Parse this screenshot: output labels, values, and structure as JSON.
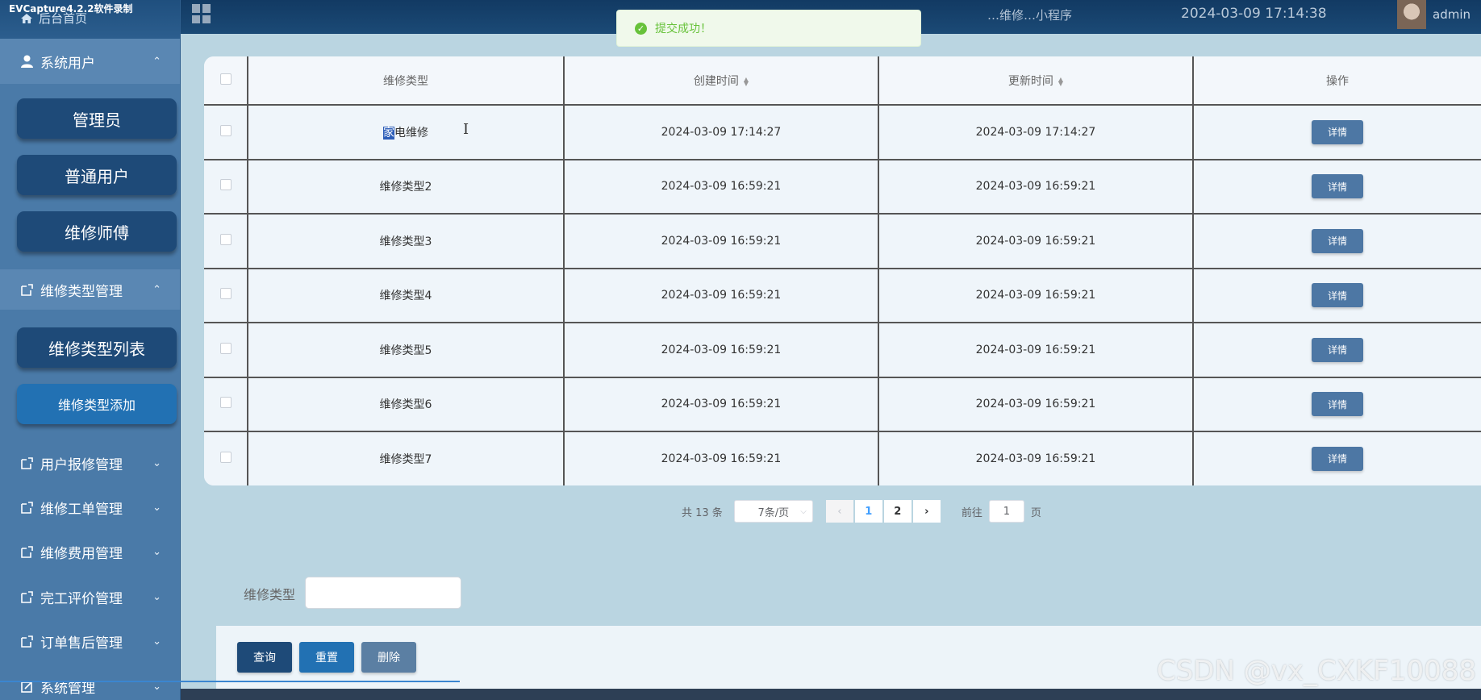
{
  "recorder_watermark": "EVCapture4.2.2软件录制",
  "sidebar": {
    "home_label": "后台首页",
    "groups": [
      {
        "label": "系统用户",
        "arrow": "⌃"
      },
      {
        "label": "维修类型管理",
        "arrow": "⌃"
      },
      {
        "label": "用户报修管理",
        "arrow": "⌄"
      },
      {
        "label": "维修工单管理",
        "arrow": "⌄"
      },
      {
        "label": "维修费用管理",
        "arrow": "⌄"
      },
      {
        "label": "完工评价管理",
        "arrow": "⌄"
      },
      {
        "label": "订单售后管理",
        "arrow": "⌄"
      },
      {
        "label": "系统管理",
        "arrow": "⌄"
      }
    ],
    "user_items": [
      "管理员",
      "普通用户",
      "维修师傅"
    ],
    "type_items": [
      "维修类型列表",
      "维修类型添加"
    ]
  },
  "header": {
    "title": "…维修…小程序",
    "datetime": "2024-03-09 17:14:38",
    "username": "admin"
  },
  "toast": {
    "message": "提交成功！"
  },
  "table": {
    "columns": [
      "维修类型",
      "创建时间",
      "更新时间",
      "操作"
    ],
    "rows": [
      {
        "type_first": "家",
        "type_rest": "电维修",
        "created": "2024-03-09 17:14:27",
        "updated": "2024-03-09 17:14:27"
      },
      {
        "type_first": "",
        "type_rest": "维修类型2",
        "created": "2024-03-09 16:59:21",
        "updated": "2024-03-09 16:59:21"
      },
      {
        "type_first": "",
        "type_rest": "维修类型3",
        "created": "2024-03-09 16:59:21",
        "updated": "2024-03-09 16:59:21"
      },
      {
        "type_first": "",
        "type_rest": "维修类型4",
        "created": "2024-03-09 16:59:21",
        "updated": "2024-03-09 16:59:21"
      },
      {
        "type_first": "",
        "type_rest": "维修类型5",
        "created": "2024-03-09 16:59:21",
        "updated": "2024-03-09 16:59:21"
      },
      {
        "type_first": "",
        "type_rest": "维修类型6",
        "created": "2024-03-09 16:59:21",
        "updated": "2024-03-09 16:59:21"
      },
      {
        "type_first": "",
        "type_rest": "维修类型7",
        "created": "2024-03-09 16:59:21",
        "updated": "2024-03-09 16:59:21"
      }
    ],
    "detail_label": "详情"
  },
  "pagination": {
    "total_text": "共 13 条",
    "page_size": "7条/页",
    "prev": "‹",
    "pages": [
      "1",
      "2"
    ],
    "next": "›",
    "goto_prefix": "前往",
    "goto_value": "1",
    "goto_suffix": "页"
  },
  "search": {
    "label": "维修类型",
    "value": ""
  },
  "actions": {
    "query": "查询",
    "reset": "重置",
    "delete": "删除"
  },
  "colors": {
    "sidebar_bg": "#4a7aa8",
    "sidebar_btn": "#1e4a78",
    "sidebar_btn_active": "#2271b3",
    "query_btn": "#1e4a78",
    "reset_btn": "#2271b3",
    "delete_btn": "#5b7fa3"
  },
  "csdn_watermark": "CSDN @vx_CXKF10088"
}
